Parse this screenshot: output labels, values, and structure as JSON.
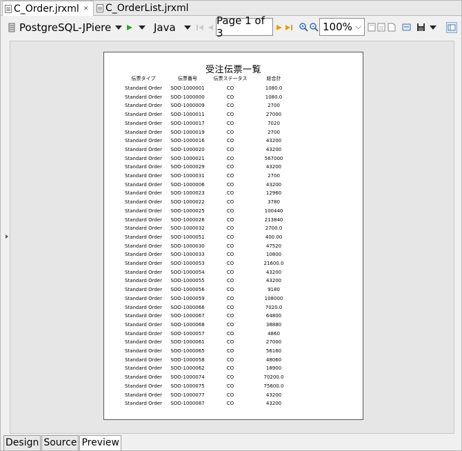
{
  "tabs": [
    {
      "label": "C_Order.jrxml",
      "active": true
    },
    {
      "label": "C_OrderList.jrxml",
      "active": false
    }
  ],
  "toolbar": {
    "datasource": "PostgreSQL-JPiere",
    "language": "Java",
    "page_label": "Page 1 of 3",
    "zoom": "100%"
  },
  "report": {
    "title": "受注伝票一覧",
    "headers": [
      "伝票タイプ",
      "伝票番号",
      "伝票ステータス",
      "総合計"
    ],
    "rows": [
      [
        "Standard Order",
        "SOO-1000001",
        "CO",
        "1080.0"
      ],
      [
        "Standard Order",
        "SOO-1000000",
        "CO",
        "1080.0"
      ],
      [
        "Standard Order",
        "SOO-1000009",
        "CO",
        "2700"
      ],
      [
        "Standard Order",
        "SOO-1000011",
        "CO",
        "27000"
      ],
      [
        "Standard Order",
        "SOO-1000017",
        "CO",
        "7020"
      ],
      [
        "Standard Order",
        "SOO-1000019",
        "CO",
        "2700"
      ],
      [
        "Standard Order",
        "SOO-1000016",
        "CO",
        "43200"
      ],
      [
        "Standard Order",
        "SOO-1000020",
        "CO",
        "43200"
      ],
      [
        "Standard Order",
        "SOO-1000021",
        "CO",
        "567000"
      ],
      [
        "Standard Order",
        "SOO-1000029",
        "CO",
        "43200"
      ],
      [
        "Standard Order",
        "SOO-1000031",
        "CO",
        "2700"
      ],
      [
        "Standard Order",
        "SOO-1000006",
        "CO",
        "43200"
      ],
      [
        "Standard Order",
        "SOO-1000023",
        "CO",
        "12960"
      ],
      [
        "Standard Order",
        "SOO-1000022",
        "CO",
        "3780"
      ],
      [
        "Standard Order",
        "SOO-1000025",
        "CO",
        "100440"
      ],
      [
        "Standard Order",
        "SOO-1000026",
        "CO",
        "213840"
      ],
      [
        "Standard Order",
        "SOO-1000032",
        "CO",
        "2700.0"
      ],
      [
        "Standard Order",
        "SOO-1000051",
        "CO",
        "400.00"
      ],
      [
        "Standard Order",
        "SOO-1000030",
        "CO",
        "47520"
      ],
      [
        "Standard Order",
        "SOO-1000033",
        "CO",
        "10800"
      ],
      [
        "Standard Order",
        "SOO-1000053",
        "CO",
        "21600.0"
      ],
      [
        "Standard Order",
        "SOO-1000054",
        "CO",
        "43200"
      ],
      [
        "Standard Order",
        "SOO-1000055",
        "CO",
        "43200"
      ],
      [
        "Standard Order",
        "SOO-1000056",
        "CO",
        "9180"
      ],
      [
        "Standard Order",
        "SOO-1000059",
        "CO",
        "108000"
      ],
      [
        "Standard Order",
        "SOO-1000066",
        "CO",
        "7020.0"
      ],
      [
        "Standard Order",
        "SOO-1000067",
        "CO",
        "64800"
      ],
      [
        "Standard Order",
        "SOO-1000068",
        "CO",
        "38880"
      ],
      [
        "Standard Order",
        "SOO-1000057",
        "CO",
        "4860"
      ],
      [
        "Standard Order",
        "SOO-1000061",
        "CO",
        "27000"
      ],
      [
        "Standard Order",
        "SOO-1000065",
        "CO",
        "56160"
      ],
      [
        "Standard Order",
        "SOO-1000058",
        "CO",
        "48060"
      ],
      [
        "Standard Order",
        "SOO-1000062",
        "CO",
        "18900"
      ],
      [
        "Standard Order",
        "SOO-1000074",
        "CO",
        "70200.0"
      ],
      [
        "Standard Order",
        "SOO-1000075",
        "CO",
        "75600.0"
      ],
      [
        "Standard Order",
        "SOO-1000077",
        "CO",
        "43200"
      ],
      [
        "Standard Order",
        "SOO-1000087",
        "CO",
        "43200"
      ]
    ]
  },
  "bottom_tabs": [
    {
      "label": "Design",
      "active": false
    },
    {
      "label": "Source",
      "active": false
    },
    {
      "label": "Preview",
      "active": true
    }
  ],
  "colors": {
    "run_green": "#2e9e2e",
    "nav_orange": "#e8a000",
    "zoom_blue": "#2a6ccf"
  }
}
